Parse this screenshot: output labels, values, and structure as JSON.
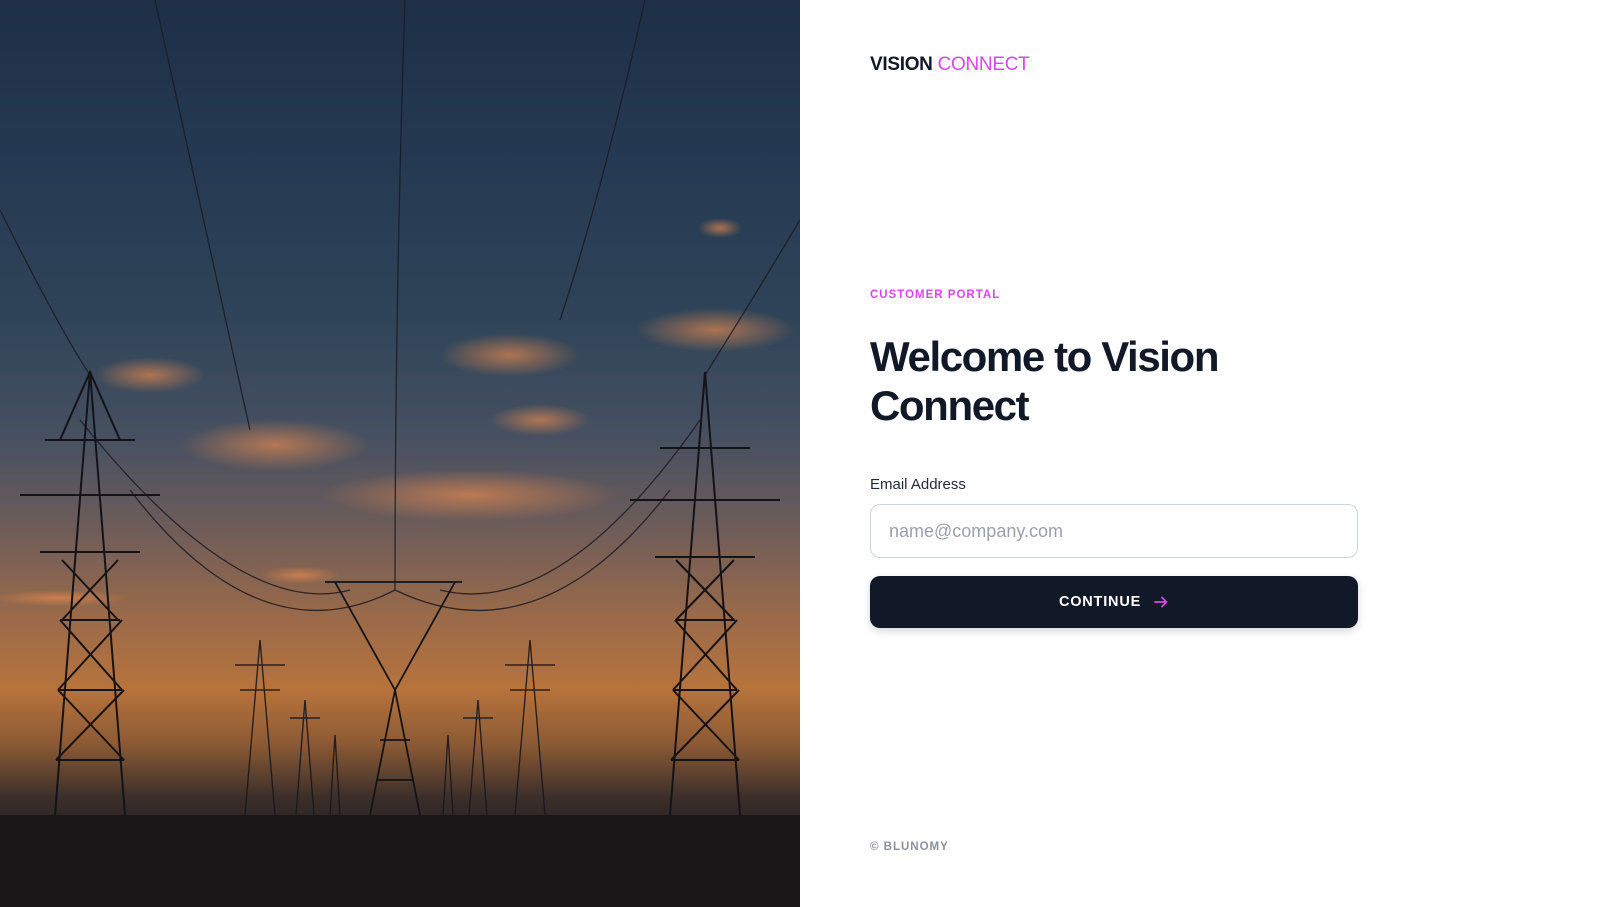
{
  "hero": {
    "image": "power-lines-sunset-photo"
  },
  "brand": {
    "primary": "VISION",
    "secondary": "CONNECT"
  },
  "eyebrow": "CUSTOMER PORTAL",
  "heading": "Welcome to Vision Connect",
  "form": {
    "email_label": "Email Address",
    "email_placeholder": "name@company.com",
    "email_value": "",
    "continue_label": "CONTINUE",
    "continue_icon": "arrow-right-icon"
  },
  "footer": "© BLUNOMY",
  "colors": {
    "accent": "#d946ef",
    "primary_dark": "#111827",
    "muted": "#8b919c"
  }
}
